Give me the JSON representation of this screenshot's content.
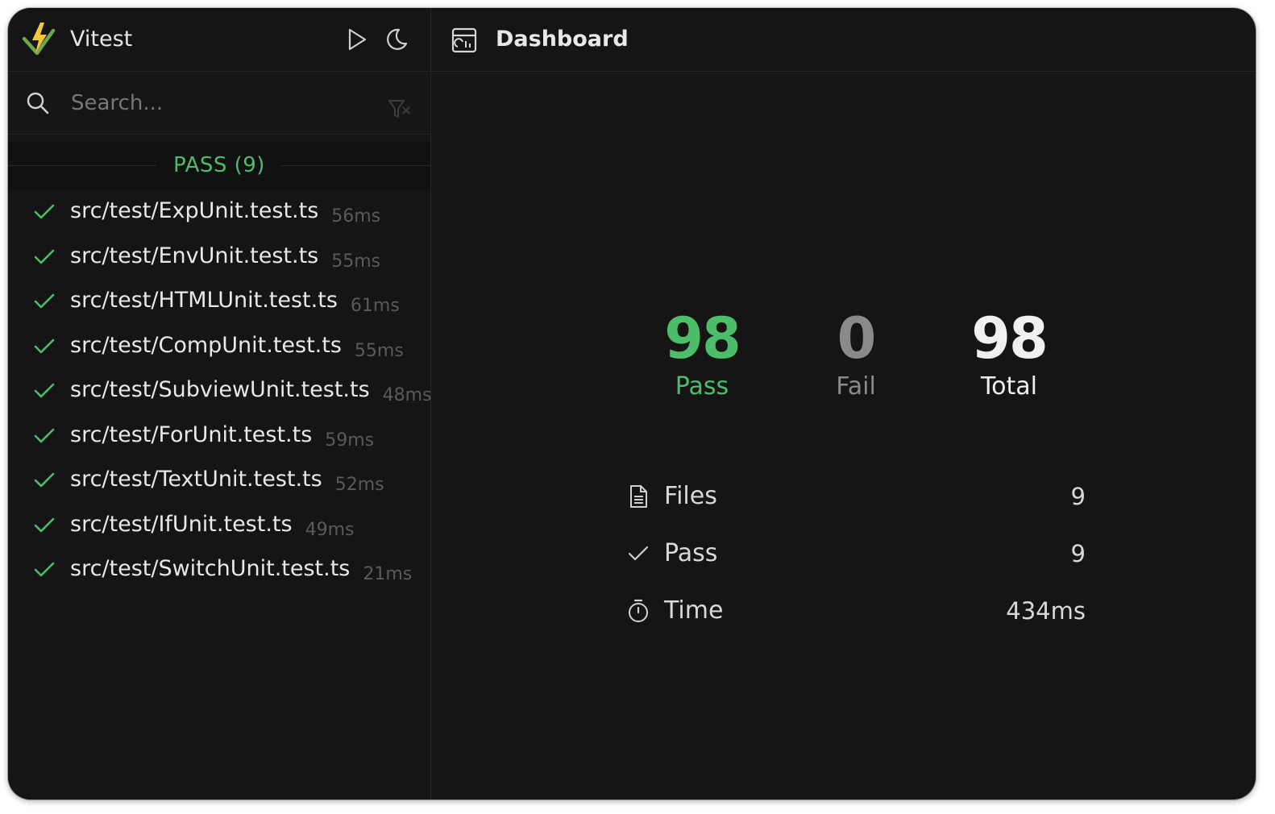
{
  "app": {
    "title": "Vitest",
    "accent_color": "#4cbe6a",
    "logo_icon": "vitest-logo-icon"
  },
  "sidebar": {
    "header_actions": [
      {
        "icon": "play-icon"
      },
      {
        "icon": "moon-icon"
      }
    ],
    "search": {
      "placeholder": "Search...",
      "value": "",
      "icon": "search-icon",
      "clear_icon": "filter-clear-icon"
    },
    "group": {
      "label": "PASS (9)"
    },
    "files": [
      {
        "name": "src/test/ExpUnit.test.ts",
        "time": "56ms"
      },
      {
        "name": "src/test/EnvUnit.test.ts",
        "time": "55ms"
      },
      {
        "name": "src/test/HTMLUnit.test.ts",
        "time": "61ms"
      },
      {
        "name": "src/test/CompUnit.test.ts",
        "time": "55ms"
      },
      {
        "name": "src/test/SubviewUnit.test.ts",
        "time": "48ms"
      },
      {
        "name": "src/test/ForUnit.test.ts",
        "time": "59ms"
      },
      {
        "name": "src/test/TextUnit.test.ts",
        "time": "52ms"
      },
      {
        "name": "src/test/IfUnit.test.ts",
        "time": "49ms"
      },
      {
        "name": "src/test/SwitchUnit.test.ts",
        "time": "21ms"
      }
    ]
  },
  "main": {
    "title": "Dashboard",
    "icon": "dashboard-icon",
    "summary": [
      {
        "value": "98",
        "label": "Pass",
        "color": "#4cbe6a"
      },
      {
        "value": "0",
        "label": "Fail",
        "color": "#8a8a8a"
      },
      {
        "value": "98",
        "label": "Total",
        "color": "#f0f0f0"
      }
    ],
    "details": [
      {
        "icon": "file-icon",
        "label": "Files",
        "value": "9"
      },
      {
        "icon": "check-icon",
        "label": "Pass",
        "value": "9"
      },
      {
        "icon": "timer-icon",
        "label": "Time",
        "value": "434ms"
      }
    ]
  }
}
